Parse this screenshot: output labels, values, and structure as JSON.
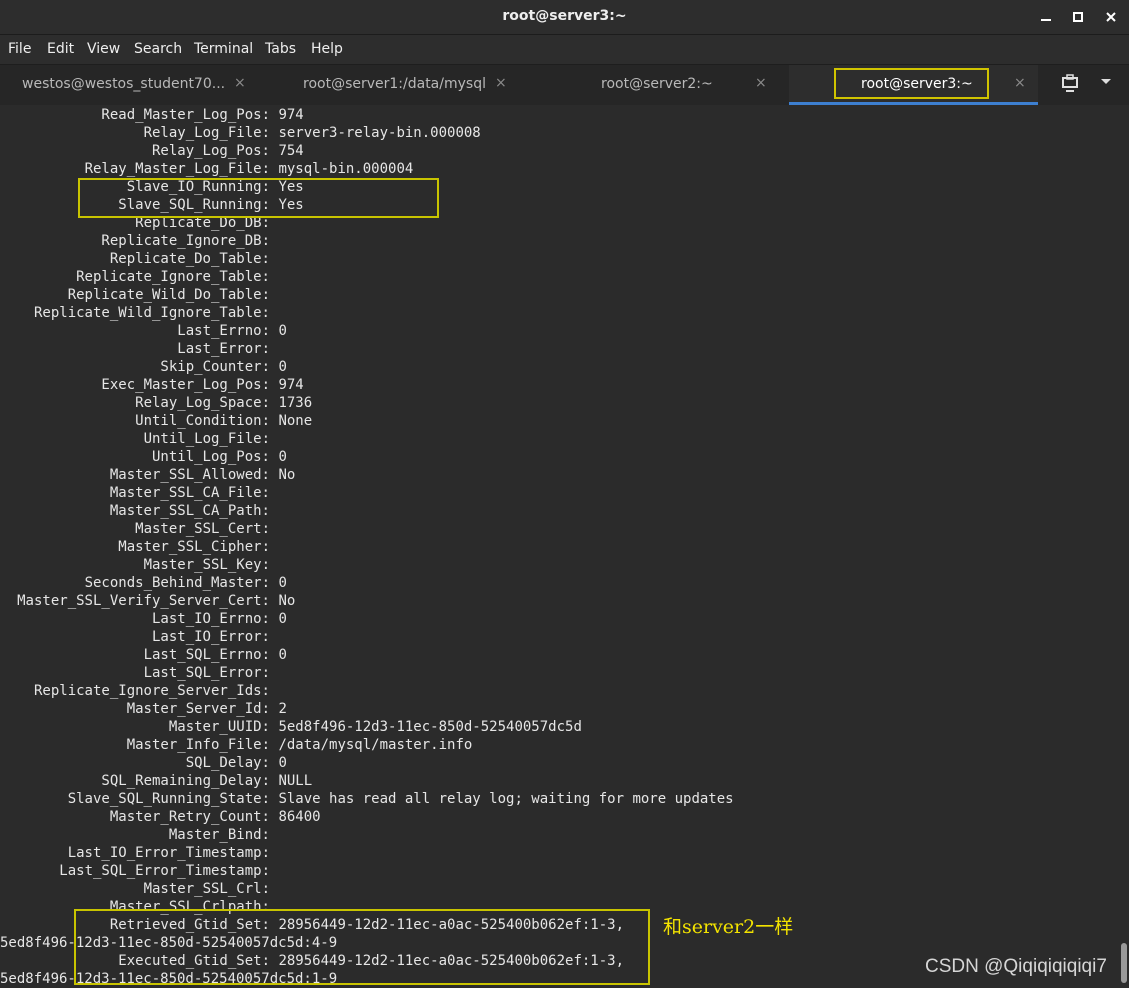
{
  "window": {
    "title": "root@server3:~"
  },
  "menu": [
    "File",
    "Edit",
    "View",
    "Search",
    "Terminal",
    "Tabs",
    "Help"
  ],
  "tabs": [
    {
      "label": "westos@westos_student70...",
      "close": "×"
    },
    {
      "label": "root@server1:/data/mysql",
      "close": "×"
    },
    {
      "label": "root@server2:~",
      "close": "×"
    },
    {
      "label": "root@server3:~",
      "close": "×"
    }
  ],
  "terminal": {
    "rows": [
      {
        "key": "Read_Master_Log_Pos:",
        "value": "974"
      },
      {
        "key": "Relay_Log_File:",
        "value": "server3-relay-bin.000008"
      },
      {
        "key": "Relay_Log_Pos:",
        "value": "754"
      },
      {
        "key": "Relay_Master_Log_File:",
        "value": "mysql-bin.000004"
      },
      {
        "key": "Slave_IO_Running:",
        "value": "Yes"
      },
      {
        "key": "Slave_SQL_Running:",
        "value": "Yes"
      },
      {
        "key": "Replicate_Do_DB:",
        "value": ""
      },
      {
        "key": "Replicate_Ignore_DB:",
        "value": ""
      },
      {
        "key": "Replicate_Do_Table:",
        "value": ""
      },
      {
        "key": "Replicate_Ignore_Table:",
        "value": ""
      },
      {
        "key": "Replicate_Wild_Do_Table:",
        "value": ""
      },
      {
        "key": "Replicate_Wild_Ignore_Table:",
        "value": ""
      },
      {
        "key": "Last_Errno:",
        "value": "0"
      },
      {
        "key": "Last_Error:",
        "value": ""
      },
      {
        "key": "Skip_Counter:",
        "value": "0"
      },
      {
        "key": "Exec_Master_Log_Pos:",
        "value": "974"
      },
      {
        "key": "Relay_Log_Space:",
        "value": "1736"
      },
      {
        "key": "Until_Condition:",
        "value": "None"
      },
      {
        "key": "Until_Log_File:",
        "value": ""
      },
      {
        "key": "Until_Log_Pos:",
        "value": "0"
      },
      {
        "key": "Master_SSL_Allowed:",
        "value": "No"
      },
      {
        "key": "Master_SSL_CA_File:",
        "value": ""
      },
      {
        "key": "Master_SSL_CA_Path:",
        "value": ""
      },
      {
        "key": "Master_SSL_Cert:",
        "value": ""
      },
      {
        "key": "Master_SSL_Cipher:",
        "value": ""
      },
      {
        "key": "Master_SSL_Key:",
        "value": ""
      },
      {
        "key": "Seconds_Behind_Master:",
        "value": "0"
      },
      {
        "key": "Master_SSL_Verify_Server_Cert:",
        "value": "No"
      },
      {
        "key": "Last_IO_Errno:",
        "value": "0"
      },
      {
        "key": "Last_IO_Error:",
        "value": ""
      },
      {
        "key": "Last_SQL_Errno:",
        "value": "0"
      },
      {
        "key": "Last_SQL_Error:",
        "value": ""
      },
      {
        "key": "Replicate_Ignore_Server_Ids:",
        "value": ""
      },
      {
        "key": "Master_Server_Id:",
        "value": "2"
      },
      {
        "key": "Master_UUID:",
        "value": "5ed8f496-12d3-11ec-850d-52540057dc5d"
      },
      {
        "key": "Master_Info_File:",
        "value": "/data/mysql/master.info"
      },
      {
        "key": "SQL_Delay:",
        "value": "0"
      },
      {
        "key": "SQL_Remaining_Delay:",
        "value": "NULL"
      },
      {
        "key": "Slave_SQL_Running_State:",
        "value": "Slave has read all relay log; waiting for more updates"
      },
      {
        "key": "Master_Retry_Count:",
        "value": "86400"
      },
      {
        "key": "Master_Bind:",
        "value": ""
      },
      {
        "key": "Last_IO_Error_Timestamp:",
        "value": ""
      },
      {
        "key": "Last_SQL_Error_Timestamp:",
        "value": ""
      },
      {
        "key": "Master_SSL_Crl:",
        "value": ""
      },
      {
        "key": "Master_SSL_Crlpath:",
        "value": ""
      },
      {
        "key": "Retrieved_Gtid_Set:",
        "value": "28956449-12d2-11ec-a0ac-525400b062ef:1-3,"
      },
      {
        "key": "",
        "value": "5ed8f496-12d3-11ec-850d-52540057dc5d:4-9",
        "wrap": true
      },
      {
        "key": "Executed_Gtid_Set:",
        "value": "28956449-12d2-11ec-a0ac-525400b062ef:1-3,"
      },
      {
        "key": "",
        "value": "5ed8f496-12d3-11ec-850d-52540057dc5d:1-9",
        "wrap": true
      }
    ]
  },
  "annotation": "和server2一样",
  "watermark": "CSDN @Qiqiqiqiqiqi7",
  "colors": {
    "highlight": "#c8c400",
    "annotation": "#f3e300",
    "tab_accent": "#3d7fd0"
  }
}
